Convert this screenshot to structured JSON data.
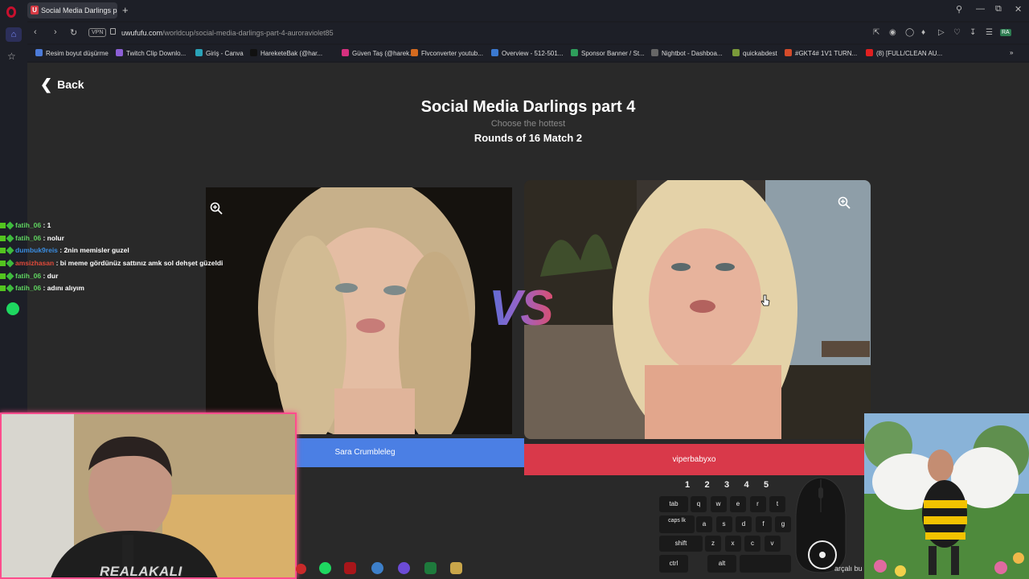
{
  "browser": {
    "tab_title": "Social Media Darlings par",
    "tab_favicon_letter": "U",
    "url_host": "uwufufu.com",
    "url_path": "/worldcup/social-media-darlings-part-4-auroraviolet85",
    "vpn_label": "VPN",
    "bookmarks": [
      {
        "label": "Resim boyut düşürme",
        "color": "#4c7bd9"
      },
      {
        "label": "Twitch Clip Downlo...",
        "color": "#8c5fd6"
      },
      {
        "label": "Giriş - Canva",
        "color": "#2aa3b8"
      },
      {
        "label": "HareketeBak (@har...",
        "color": "#111111"
      },
      {
        "label": "Güven Taş (@harek...",
        "color": "#d6307f"
      },
      {
        "label": "Flvconverter youtub...",
        "color": "#d46a1f"
      },
      {
        "label": "Overview - 512-501...",
        "color": "#3b79d0"
      },
      {
        "label": "Sponsor Banner / St...",
        "color": "#2e9e5b"
      },
      {
        "label": "Nightbot - Dashboa...",
        "color": "#666666"
      },
      {
        "label": "quickabdest",
        "color": "#7a9a3a"
      },
      {
        "label": "#GKT4# 1V1 TURN...",
        "color": "#d44b2a"
      },
      {
        "label": "(8) [FULL/CLEAN AU...",
        "color": "#e02020"
      }
    ]
  },
  "page": {
    "back_label": "Back",
    "title": "Social Media Darlings part 4",
    "subtitle": "Choose the hottest",
    "round_label": "Rounds of 16 Match 2",
    "vs_label": "VS",
    "left_name": "Sara Crumbleleg",
    "right_name": "viperbabyxo"
  },
  "chat": [
    {
      "user": "fatih_06",
      "msg": ": 1",
      "color": "#5fd35f"
    },
    {
      "user": "fatih_06",
      "msg": ": nolur",
      "color": "#5fd35f"
    },
    {
      "user": "dumbuk9reis",
      "msg": ": 2nin memisler guzel",
      "color": "#3a8de0"
    },
    {
      "user": "amsizhasan",
      "msg": ": bi meme gördünüz sattınız amk sol dehşet güzeldi",
      "color": "#e04a3a"
    },
    {
      "user": "fatih_06",
      "msg": ": dur",
      "color": "#5fd35f"
    },
    {
      "user": "fatih_06",
      "msg": ": adını alıyım",
      "color": "#5fd35f"
    }
  ],
  "stream": {
    "cam_name": "REALAKALI",
    "ticker_text": "arçalı bu"
  },
  "keyboard": {
    "numbers": [
      "1",
      "2",
      "3",
      "4",
      "5"
    ],
    "row1": [
      "tab",
      "q",
      "w",
      "e",
      "r",
      "t"
    ],
    "row2_first": "caps lk",
    "row2": [
      "a",
      "s",
      "d",
      "f",
      "g"
    ],
    "row3_first": "shift",
    "row3": [
      "z",
      "x",
      "c",
      "v"
    ],
    "row4": [
      "ctrl",
      "alt"
    ]
  }
}
